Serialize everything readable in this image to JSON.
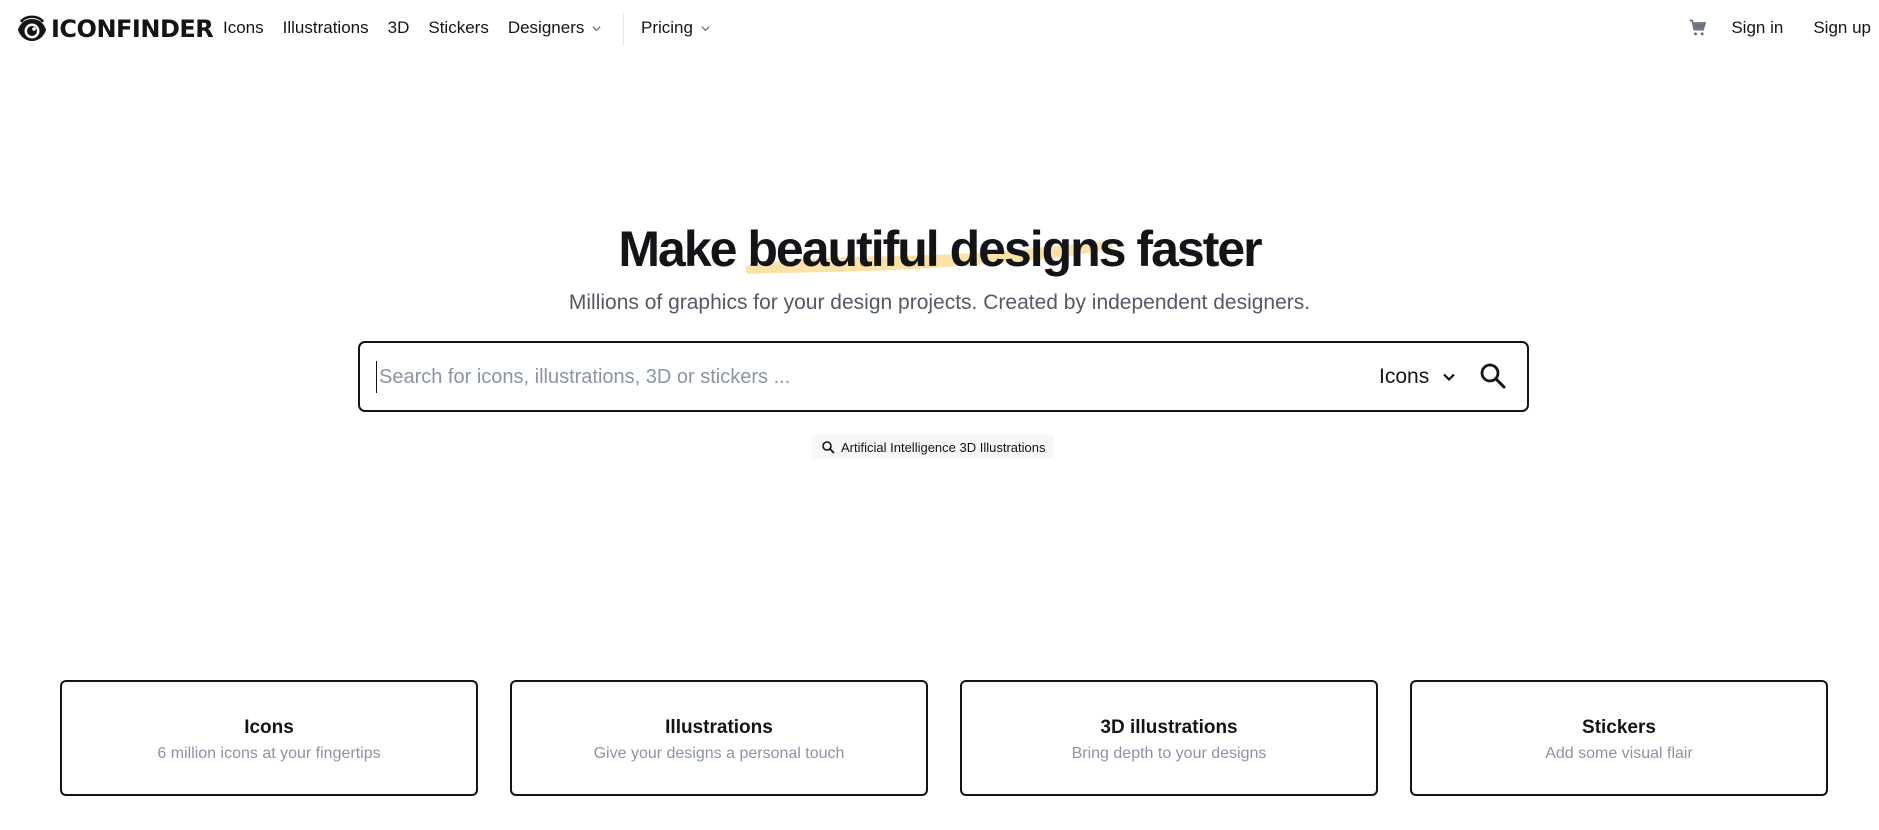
{
  "header": {
    "logo_text": "ICONFINDER",
    "nav": [
      {
        "label": "Icons"
      },
      {
        "label": "Illustrations"
      },
      {
        "label": "3D"
      },
      {
        "label": "Stickers"
      },
      {
        "label": "Designers"
      }
    ],
    "pricing_label": "Pricing",
    "sign_in": "Sign in",
    "sign_up": "Sign up"
  },
  "hero": {
    "title_start": "Make ",
    "title_highlight": "beautiful designs",
    "title_end": " faster",
    "subtitle": "Millions of graphics for your design projects. Created by independent designers.",
    "highlight_color": "#fde2a8"
  },
  "search": {
    "placeholder": "Search for icons, illustrations, 3D or stickers ...",
    "value": "",
    "type_selected": "Icons"
  },
  "suggestion": {
    "label": "Artificial Intelligence 3D Illustrations"
  },
  "cards": [
    {
      "title": "Icons",
      "subtitle": "6 million icons at your fingertips"
    },
    {
      "title": "Illustrations",
      "subtitle": "Give your designs a personal touch"
    },
    {
      "title": "3D illustrations",
      "subtitle": "Bring depth to your designs"
    },
    {
      "title": "Stickers",
      "subtitle": "Add some visual flair"
    }
  ],
  "colors": {
    "text": "#121417",
    "muted": "#8a94a6",
    "subtitle": "#525a66"
  }
}
